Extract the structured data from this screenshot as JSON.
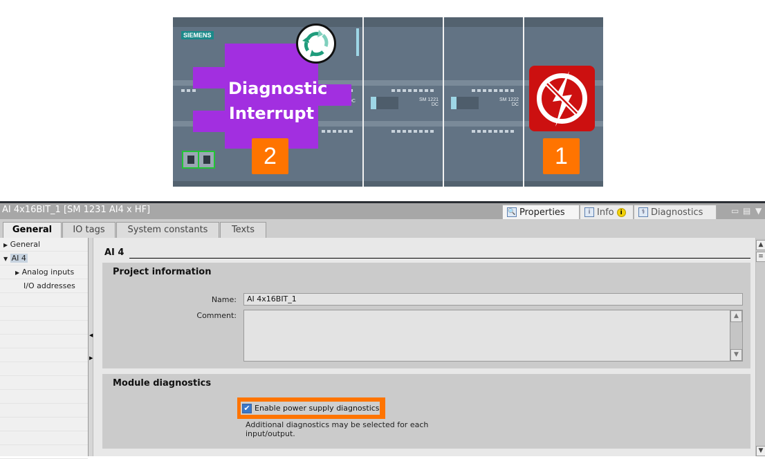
{
  "hardware": {
    "brand": "SIEMENS",
    "modules": [
      {
        "label_line1": "SM 1221",
        "label_line2": "DC"
      },
      {
        "label_line1": "SM 1222",
        "label_line2": "DC"
      }
    ],
    "cpu_partial_label": "DC/DC/DC",
    "callout_text_line1": "Diagnostic",
    "callout_text_line2": "Interrupt",
    "badge_interrupt": "2",
    "badge_power": "1",
    "icons": {
      "cycle": "cycle-arrows-icon",
      "power": "no-power-icon",
      "ports": "ethernet-port-icon"
    }
  },
  "panel": {
    "title": "AI 4x16BIT_1 [SM 1231 AI4 x HF]",
    "right_tabs": [
      {
        "label": "Properties",
        "icon": "properties-icon",
        "active": true
      },
      {
        "label": "Info",
        "icon": "info-icon",
        "active": false,
        "badge": "i"
      },
      {
        "label": "Diagnostics",
        "icon": "diagnostics-icon",
        "active": false
      }
    ],
    "window_controls": {
      "restore": "▭",
      "menu": "▤",
      "dropdown": "▼"
    },
    "tabs": [
      {
        "label": "General",
        "active": true
      },
      {
        "label": "IO tags",
        "active": false
      },
      {
        "label": "System constants",
        "active": false
      },
      {
        "label": "Texts",
        "active": false
      }
    ],
    "nav": [
      {
        "label": "General",
        "expander": "▶",
        "level": 0
      },
      {
        "label": "AI 4",
        "expander": "▼",
        "level": 0,
        "selected": true
      },
      {
        "label": "Analog inputs",
        "expander": "▶",
        "level": 1
      },
      {
        "label": "I/O addresses",
        "expander": "",
        "level": 1
      }
    ],
    "section_title": "AI 4",
    "project_info": {
      "title": "Project information",
      "name_label": "Name:",
      "name_value": "AI 4x16BIT_1",
      "comment_label": "Comment:",
      "comment_value": ""
    },
    "module_diag": {
      "title": "Module diagnostics",
      "checkbox_label": "Enable power supply diagnostics",
      "checked": true,
      "note": "Additional diagnostics may be selected for each input/output."
    }
  }
}
